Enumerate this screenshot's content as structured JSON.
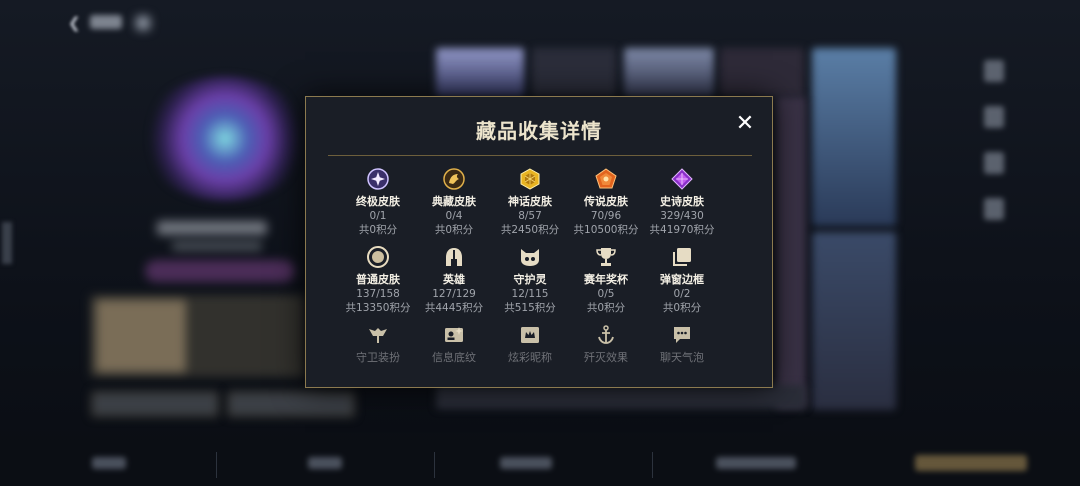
{
  "header": {
    "back_icon": "chevron-left-icon"
  },
  "modal": {
    "title": "藏品收集详情",
    "close_label": "✕",
    "row1": [
      {
        "icon": "supreme-skin-icon",
        "label": "终极皮肤",
        "count": "0/1",
        "points": "共0积分"
      },
      {
        "icon": "collection-skin-icon",
        "label": "典藏皮肤",
        "count": "0/4",
        "points": "共0积分"
      },
      {
        "icon": "myth-skin-icon",
        "label": "神话皮肤",
        "count": "8/57",
        "points": "共2450积分"
      },
      {
        "icon": "legend-skin-icon",
        "label": "传说皮肤",
        "count": "70/96",
        "points": "共10500积分"
      },
      {
        "icon": "epic-skin-icon",
        "label": "史诗皮肤",
        "count": "329/430",
        "points": "共41970积分"
      }
    ],
    "row2": [
      {
        "icon": "normal-skin-icon",
        "label": "普通皮肤",
        "count": "137/158",
        "points": "共13350积分"
      },
      {
        "icon": "hero-helmet-icon",
        "label": "英雄",
        "count": "127/129",
        "points": "共4445积分"
      },
      {
        "icon": "guardian-spirit-icon",
        "label": "守护灵",
        "count": "12/115",
        "points": "共515积分"
      },
      {
        "icon": "trophy-icon",
        "label": "赛年奖杯",
        "count": "0/5",
        "points": "共0积分"
      },
      {
        "icon": "popup-frame-icon",
        "label": "弹窗边框",
        "count": "0/2",
        "points": "共0积分"
      }
    ],
    "row3": [
      {
        "icon": "guardian-outfit-icon",
        "label": "守卫装扮"
      },
      {
        "icon": "info-card-icon",
        "label": "信息底纹"
      },
      {
        "icon": "nickname-icon",
        "label": "炫彩昵称"
      },
      {
        "icon": "anchor-icon",
        "label": "歼灭效果"
      },
      {
        "icon": "chat-bubble-icon",
        "label": "聊天气泡"
      }
    ]
  },
  "colors": {
    "accent_gold": "#c9a24a",
    "border": "#8c7a4f",
    "panel": "#1a1e26"
  }
}
